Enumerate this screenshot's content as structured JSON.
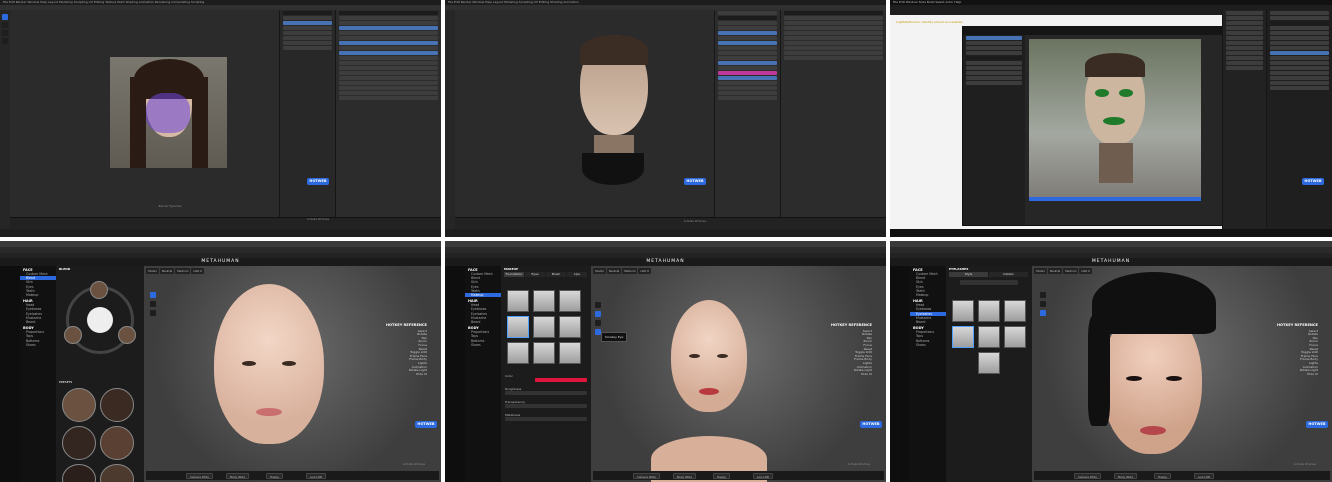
{
  "blender_panels": [
    {
      "menu": "File  Edit  Render  Window  Help   Layout  Modeling  Sculpting  UV Editing  Texture Paint  Shading  Animation  Rendering  Compositing  Scripting",
      "viewport_caption": "Blender Hyperreal",
      "badge": "HOTWEB",
      "watermark": "Activate Windows",
      "watermark_sub": "Go to Settings to activate Windows."
    },
    {
      "menu": "File  Edit  Render  Window  Help   Layout  Modeling  Sculpting  UV Editing  Shading  Animation",
      "badge": "HOTWEB",
      "watermark": "Activate Windows",
      "watermark_sub": "Go to Settings to activate Windows."
    },
    {
      "menu": "File  Edit  Window  Tools  Build  Select  Actor  Help",
      "badge": "HOTWEB",
      "output_line": "LogMetaHuman: Identity solved successfully"
    }
  ],
  "metahuman_panels": [
    {
      "title": "METAHUMAN",
      "panel_heading": "BLEND",
      "presets_heading": "PRESETS",
      "nav": [
        {
          "h": "FACE"
        },
        {
          "i": "Custom Mesh"
        },
        {
          "i": "Blend",
          "sel": true
        },
        {
          "i": "Skin"
        },
        {
          "i": "Eyes"
        },
        {
          "i": "Teeth"
        },
        {
          "i": "Makeup"
        },
        {
          "h": "HAIR"
        },
        {
          "i": "Head"
        },
        {
          "i": "Eyebrows"
        },
        {
          "i": "Eyelashes"
        },
        {
          "i": "Mustache"
        },
        {
          "i": "Beard"
        },
        {
          "h": "BODY"
        },
        {
          "i": "Proportions"
        },
        {
          "i": "Tops"
        },
        {
          "i": "Bottoms"
        },
        {
          "i": "Shoes"
        }
      ],
      "bottom": [
        "Camera Wide",
        "Body Wide",
        "Happy",
        "Low LOD"
      ],
      "badge": "HOTWEB",
      "watermark": "Activate Windows"
    },
    {
      "title": "METAHUMAN",
      "panel_heading": "MAKEUP",
      "tabs": [
        "Foundation",
        "Eyes",
        "Blush",
        "Lips"
      ],
      "tooltip": "Smokey Eye",
      "sliders": [
        "Color",
        "Roughness",
        "Transparency",
        "Metalness"
      ],
      "nav": [
        {
          "h": "FACE"
        },
        {
          "i": "Custom Mesh"
        },
        {
          "i": "Blend"
        },
        {
          "i": "Skin"
        },
        {
          "i": "Eyes"
        },
        {
          "i": "Teeth"
        },
        {
          "i": "Makeup",
          "sel": true
        },
        {
          "h": "HAIR"
        },
        {
          "i": "Head"
        },
        {
          "i": "Eyebrows"
        },
        {
          "i": "Eyelashes"
        },
        {
          "i": "Mustache"
        },
        {
          "i": "Beard"
        },
        {
          "h": "BODY"
        },
        {
          "i": "Proportions"
        },
        {
          "i": "Tops"
        },
        {
          "i": "Bottoms"
        },
        {
          "i": "Shoes"
        }
      ],
      "bottom": [
        "Camera Wide",
        "Body Wide",
        "Happy",
        "Low LOD"
      ],
      "badge": "HOTWEB",
      "watermark": "Activate Windows"
    },
    {
      "title": "METAHUMAN",
      "panel_heading": "EYELASHES",
      "tabs": [
        "Style",
        "Details"
      ],
      "nav": [
        {
          "h": "FACE"
        },
        {
          "i": "Custom Mesh"
        },
        {
          "i": "Blend"
        },
        {
          "i": "Skin"
        },
        {
          "i": "Eyes"
        },
        {
          "i": "Teeth"
        },
        {
          "i": "Makeup"
        },
        {
          "h": "HAIR"
        },
        {
          "i": "Head"
        },
        {
          "i": "Eyebrows"
        },
        {
          "i": "Eyelashes",
          "sel": true
        },
        {
          "i": "Mustache"
        },
        {
          "i": "Beard"
        },
        {
          "h": "BODY"
        },
        {
          "i": "Proportions"
        },
        {
          "i": "Tops"
        },
        {
          "i": "Bottoms"
        },
        {
          "i": "Shoes"
        }
      ],
      "bottom": [
        "Camera Wide",
        "Body Wide",
        "Happy",
        "Low LOD"
      ],
      "badge": "HOTWEB",
      "watermark": "Activate Windows"
    }
  ],
  "reference": {
    "title": "HOTKEY REFERENCE",
    "lines": [
      "Select",
      "Rotate",
      "Pan",
      "Zoom",
      "Focus",
      "Reset",
      "Toggle LOD",
      "Frame Face",
      "Frame Body",
      "Lights",
      "Animation",
      "Rotate Light",
      "Hide UI"
    ]
  },
  "viewport_tools": [
    "Studio",
    "Neutral",
    "Medium",
    "LOD 0"
  ],
  "colors": {
    "accent": "#2d6ae0",
    "lip_red": "#e0163f"
  }
}
